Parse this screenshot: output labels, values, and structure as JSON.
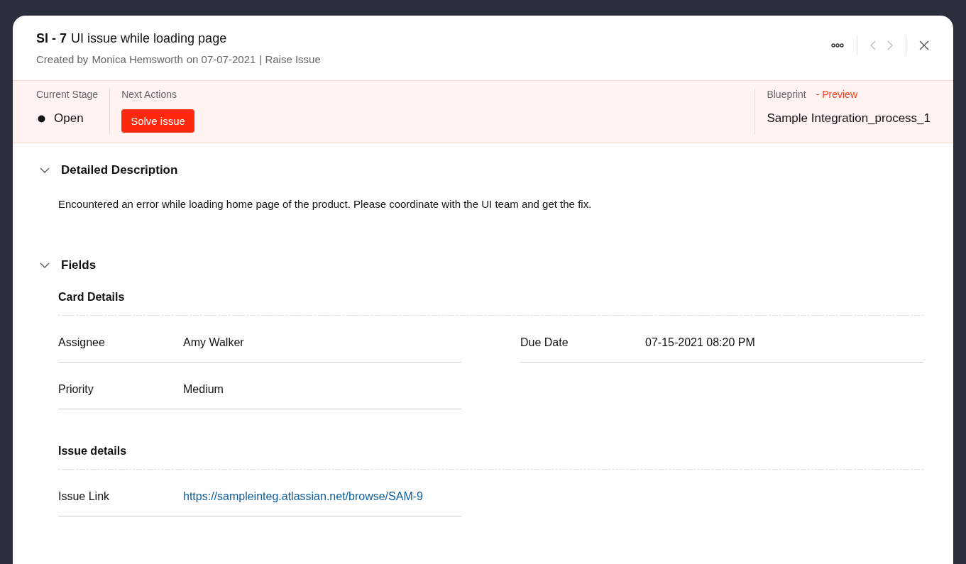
{
  "record": {
    "id": "SI - 7",
    "title": "UI issue while loading page",
    "created_by_label": "Created by",
    "creator": "Monica Hemsworth",
    "created_on": "on 07-07-2021",
    "layout": "| Raise Issue"
  },
  "stage_bar": {
    "current_stage_label": "Current Stage",
    "current_stage": "Open",
    "next_actions_label": "Next Actions",
    "actions": [
      "Solve issue"
    ],
    "blueprint_label": "Blueprint",
    "blueprint_link": "- Preview",
    "blueprint_name": "Sample Integration_process_1"
  },
  "sections": [
    {
      "title": "Detailed Description",
      "expanded": true,
      "kind": "text",
      "text": "Encountered an error while loading home page of the product. Please coordinate with the UI team and get the fix."
    },
    {
      "title": "Fields",
      "expanded": true,
      "kind": "fields",
      "groups": [
        {
          "title": "Card Details",
          "fields": [
            {
              "label": "Assignee",
              "value": "Amy Walker",
              "kind": "text"
            },
            {
              "label": "Due Date",
              "value": "07-15-2021 08:20 PM",
              "kind": "text"
            },
            {
              "label": "Priority",
              "value": "Medium",
              "kind": "text"
            }
          ]
        },
        {
          "title": "Issue details",
          "fields": [
            {
              "label": "Issue Link",
              "value": "https://sampleinteg.atlassian.net/browse/SAM-9",
              "kind": "link"
            }
          ]
        }
      ]
    }
  ]
}
